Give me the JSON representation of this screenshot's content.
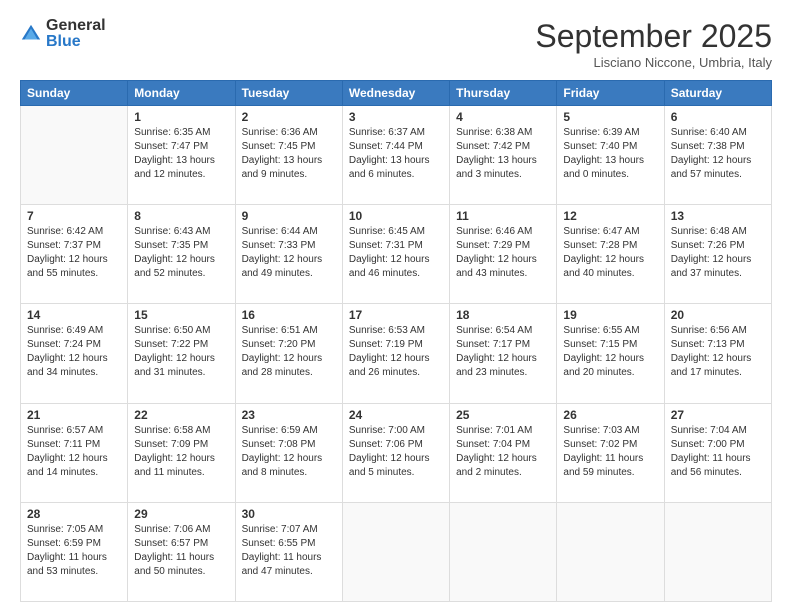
{
  "logo": {
    "general": "General",
    "blue": "Blue"
  },
  "header": {
    "title": "September 2025",
    "location": "Lisciano Niccone, Umbria, Italy"
  },
  "days_of_week": [
    "Sunday",
    "Monday",
    "Tuesday",
    "Wednesday",
    "Thursday",
    "Friday",
    "Saturday"
  ],
  "weeks": [
    [
      {
        "day": "",
        "sunrise": "",
        "sunset": "",
        "daylight": ""
      },
      {
        "day": "1",
        "sunrise": "Sunrise: 6:35 AM",
        "sunset": "Sunset: 7:47 PM",
        "daylight": "Daylight: 13 hours and 12 minutes."
      },
      {
        "day": "2",
        "sunrise": "Sunrise: 6:36 AM",
        "sunset": "Sunset: 7:45 PM",
        "daylight": "Daylight: 13 hours and 9 minutes."
      },
      {
        "day": "3",
        "sunrise": "Sunrise: 6:37 AM",
        "sunset": "Sunset: 7:44 PM",
        "daylight": "Daylight: 13 hours and 6 minutes."
      },
      {
        "day": "4",
        "sunrise": "Sunrise: 6:38 AM",
        "sunset": "Sunset: 7:42 PM",
        "daylight": "Daylight: 13 hours and 3 minutes."
      },
      {
        "day": "5",
        "sunrise": "Sunrise: 6:39 AM",
        "sunset": "Sunset: 7:40 PM",
        "daylight": "Daylight: 13 hours and 0 minutes."
      },
      {
        "day": "6",
        "sunrise": "Sunrise: 6:40 AM",
        "sunset": "Sunset: 7:38 PM",
        "daylight": "Daylight: 12 hours and 57 minutes."
      }
    ],
    [
      {
        "day": "7",
        "sunrise": "Sunrise: 6:42 AM",
        "sunset": "Sunset: 7:37 PM",
        "daylight": "Daylight: 12 hours and 55 minutes."
      },
      {
        "day": "8",
        "sunrise": "Sunrise: 6:43 AM",
        "sunset": "Sunset: 7:35 PM",
        "daylight": "Daylight: 12 hours and 52 minutes."
      },
      {
        "day": "9",
        "sunrise": "Sunrise: 6:44 AM",
        "sunset": "Sunset: 7:33 PM",
        "daylight": "Daylight: 12 hours and 49 minutes."
      },
      {
        "day": "10",
        "sunrise": "Sunrise: 6:45 AM",
        "sunset": "Sunset: 7:31 PM",
        "daylight": "Daylight: 12 hours and 46 minutes."
      },
      {
        "day": "11",
        "sunrise": "Sunrise: 6:46 AM",
        "sunset": "Sunset: 7:29 PM",
        "daylight": "Daylight: 12 hours and 43 minutes."
      },
      {
        "day": "12",
        "sunrise": "Sunrise: 6:47 AM",
        "sunset": "Sunset: 7:28 PM",
        "daylight": "Daylight: 12 hours and 40 minutes."
      },
      {
        "day": "13",
        "sunrise": "Sunrise: 6:48 AM",
        "sunset": "Sunset: 7:26 PM",
        "daylight": "Daylight: 12 hours and 37 minutes."
      }
    ],
    [
      {
        "day": "14",
        "sunrise": "Sunrise: 6:49 AM",
        "sunset": "Sunset: 7:24 PM",
        "daylight": "Daylight: 12 hours and 34 minutes."
      },
      {
        "day": "15",
        "sunrise": "Sunrise: 6:50 AM",
        "sunset": "Sunset: 7:22 PM",
        "daylight": "Daylight: 12 hours and 31 minutes."
      },
      {
        "day": "16",
        "sunrise": "Sunrise: 6:51 AM",
        "sunset": "Sunset: 7:20 PM",
        "daylight": "Daylight: 12 hours and 28 minutes."
      },
      {
        "day": "17",
        "sunrise": "Sunrise: 6:53 AM",
        "sunset": "Sunset: 7:19 PM",
        "daylight": "Daylight: 12 hours and 26 minutes."
      },
      {
        "day": "18",
        "sunrise": "Sunrise: 6:54 AM",
        "sunset": "Sunset: 7:17 PM",
        "daylight": "Daylight: 12 hours and 23 minutes."
      },
      {
        "day": "19",
        "sunrise": "Sunrise: 6:55 AM",
        "sunset": "Sunset: 7:15 PM",
        "daylight": "Daylight: 12 hours and 20 minutes."
      },
      {
        "day": "20",
        "sunrise": "Sunrise: 6:56 AM",
        "sunset": "Sunset: 7:13 PM",
        "daylight": "Daylight: 12 hours and 17 minutes."
      }
    ],
    [
      {
        "day": "21",
        "sunrise": "Sunrise: 6:57 AM",
        "sunset": "Sunset: 7:11 PM",
        "daylight": "Daylight: 12 hours and 14 minutes."
      },
      {
        "day": "22",
        "sunrise": "Sunrise: 6:58 AM",
        "sunset": "Sunset: 7:09 PM",
        "daylight": "Daylight: 12 hours and 11 minutes."
      },
      {
        "day": "23",
        "sunrise": "Sunrise: 6:59 AM",
        "sunset": "Sunset: 7:08 PM",
        "daylight": "Daylight: 12 hours and 8 minutes."
      },
      {
        "day": "24",
        "sunrise": "Sunrise: 7:00 AM",
        "sunset": "Sunset: 7:06 PM",
        "daylight": "Daylight: 12 hours and 5 minutes."
      },
      {
        "day": "25",
        "sunrise": "Sunrise: 7:01 AM",
        "sunset": "Sunset: 7:04 PM",
        "daylight": "Daylight: 12 hours and 2 minutes."
      },
      {
        "day": "26",
        "sunrise": "Sunrise: 7:03 AM",
        "sunset": "Sunset: 7:02 PM",
        "daylight": "Daylight: 11 hours and 59 minutes."
      },
      {
        "day": "27",
        "sunrise": "Sunrise: 7:04 AM",
        "sunset": "Sunset: 7:00 PM",
        "daylight": "Daylight: 11 hours and 56 minutes."
      }
    ],
    [
      {
        "day": "28",
        "sunrise": "Sunrise: 7:05 AM",
        "sunset": "Sunset: 6:59 PM",
        "daylight": "Daylight: 11 hours and 53 minutes."
      },
      {
        "day": "29",
        "sunrise": "Sunrise: 7:06 AM",
        "sunset": "Sunset: 6:57 PM",
        "daylight": "Daylight: 11 hours and 50 minutes."
      },
      {
        "day": "30",
        "sunrise": "Sunrise: 7:07 AM",
        "sunset": "Sunset: 6:55 PM",
        "daylight": "Daylight: 11 hours and 47 minutes."
      },
      {
        "day": "",
        "sunrise": "",
        "sunset": "",
        "daylight": ""
      },
      {
        "day": "",
        "sunrise": "",
        "sunset": "",
        "daylight": ""
      },
      {
        "day": "",
        "sunrise": "",
        "sunset": "",
        "daylight": ""
      },
      {
        "day": "",
        "sunrise": "",
        "sunset": "",
        "daylight": ""
      }
    ]
  ]
}
